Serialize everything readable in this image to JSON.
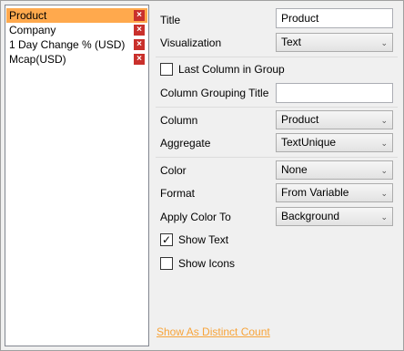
{
  "columns": {
    "items": [
      {
        "label": "Product",
        "selected": true
      },
      {
        "label": "Company",
        "selected": false
      },
      {
        "label": "1 Day Change % (USD)",
        "selected": false
      },
      {
        "label": "Mcap(USD)",
        "selected": false
      }
    ],
    "delete_glyph": "×"
  },
  "form": {
    "title_label": "Title",
    "title_value": "Product",
    "visualization_label": "Visualization",
    "visualization_value": "Text",
    "last_column_label": "Last Column in Group",
    "last_column_checked": false,
    "grouping_title_label": "Column Grouping Title",
    "grouping_title_value": "",
    "column_label": "Column",
    "column_value": "Product",
    "aggregate_label": "Aggregate",
    "aggregate_value": "TextUnique",
    "color_label": "Color",
    "color_value": "None",
    "format_label": "Format",
    "format_value": "From Variable",
    "apply_color_label": "Apply Color To",
    "apply_color_value": "Background",
    "show_text_label": "Show Text",
    "show_text_checked": true,
    "show_icons_label": "Show Icons",
    "show_icons_checked": false,
    "distinct_link": "Show As Distinct Count"
  },
  "colors": {
    "selected_row": "#ffa94d",
    "delete_button": "#c9302c",
    "link": "#f7a43a"
  }
}
